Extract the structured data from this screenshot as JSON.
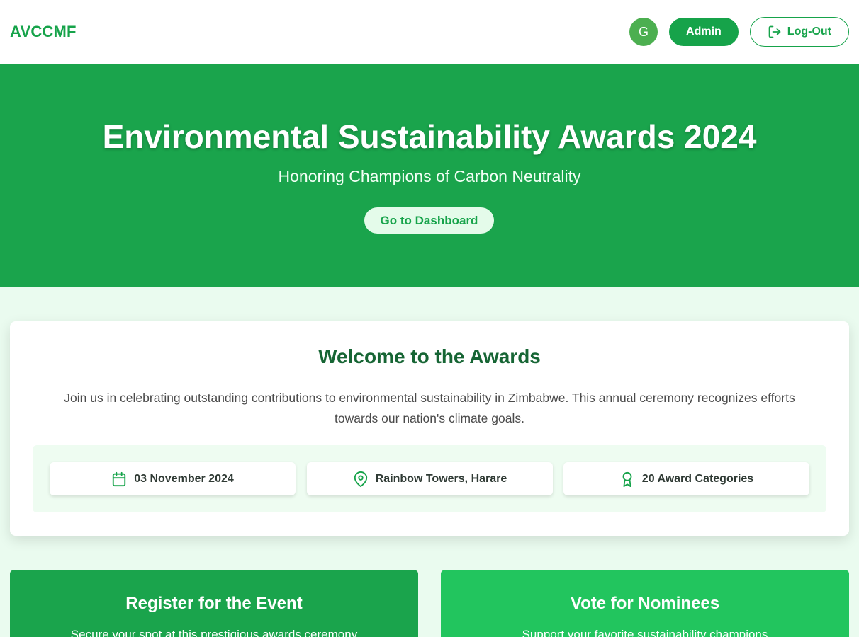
{
  "header": {
    "brand": "AVCCMF",
    "avatar_initial": "G",
    "admin_label": "Admin",
    "logout_label": "Log-Out"
  },
  "hero": {
    "title": "Environmental Sustainability Awards 2024",
    "subtitle": "Honoring Champions of Carbon Neutrality",
    "dashboard_button": "Go to Dashboard"
  },
  "welcome": {
    "title": "Welcome to the Awards",
    "text": "Join us in celebrating outstanding contributions to environmental sustainability in Zimbabwe. This annual ceremony recognizes efforts towards our nation's climate goals.",
    "info": [
      {
        "icon": "calendar-icon",
        "label": "03 November 2024"
      },
      {
        "icon": "map-pin-icon",
        "label": "Rainbow Towers, Harare"
      },
      {
        "icon": "award-icon",
        "label": "20 Award Categories"
      }
    ]
  },
  "cards": [
    {
      "title": "Register for the Event",
      "text": "Secure your spot at this prestigious awards ceremony"
    },
    {
      "title": "Vote for Nominees",
      "text": "Support your favorite sustainability champions"
    }
  ],
  "colors": {
    "primary": "#16a34a",
    "hero_bg": "#1aa44c",
    "vote_bg": "#22c55e",
    "page_bg": "#eafbef",
    "heading_dark": "#166534"
  }
}
